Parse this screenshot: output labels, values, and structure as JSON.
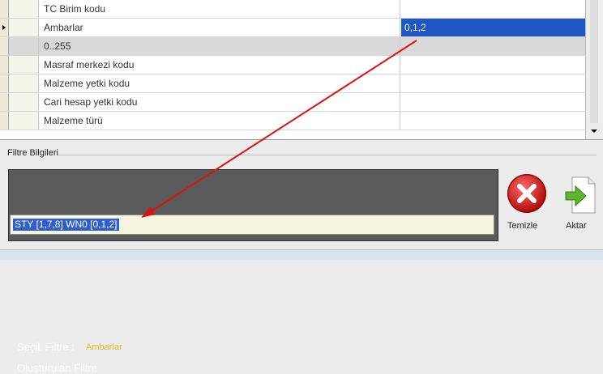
{
  "grid": {
    "rows": [
      {
        "label": "TC Birim kodu",
        "value": "",
        "current": false,
        "grey": false
      },
      {
        "label": "Ambarlar",
        "value": "0,1,2",
        "current": true,
        "grey": false
      },
      {
        "label": "0..255",
        "value": "",
        "current": false,
        "grey": true
      },
      {
        "label": "Masraf merkezi kodu",
        "value": "",
        "current": false,
        "grey": false
      },
      {
        "label": "Malzeme yetki kodu",
        "value": "",
        "current": false,
        "grey": false
      },
      {
        "label": "Cari hesap yetki kodu",
        "value": "",
        "current": false,
        "grey": false
      },
      {
        "label": "Malzeme türü",
        "value": "",
        "current": false,
        "grey": false
      }
    ]
  },
  "filter": {
    "group_title": "Filtre Bilgileri",
    "selected_label": "Seçili Filtre :",
    "selected_value": "Ambarlar",
    "built_label": "Oluşturulan Filtre",
    "built_value": "STY [1,7,8] WN0 [0,1,2]"
  },
  "buttons": {
    "clear_label": "Temizle",
    "transfer_label": "Aktar"
  },
  "colors": {
    "selection": "#1f58c4",
    "annotation_arrow": "#e01010",
    "panel": "#5a5a5a",
    "selected_value_text": "#d6c01f"
  }
}
